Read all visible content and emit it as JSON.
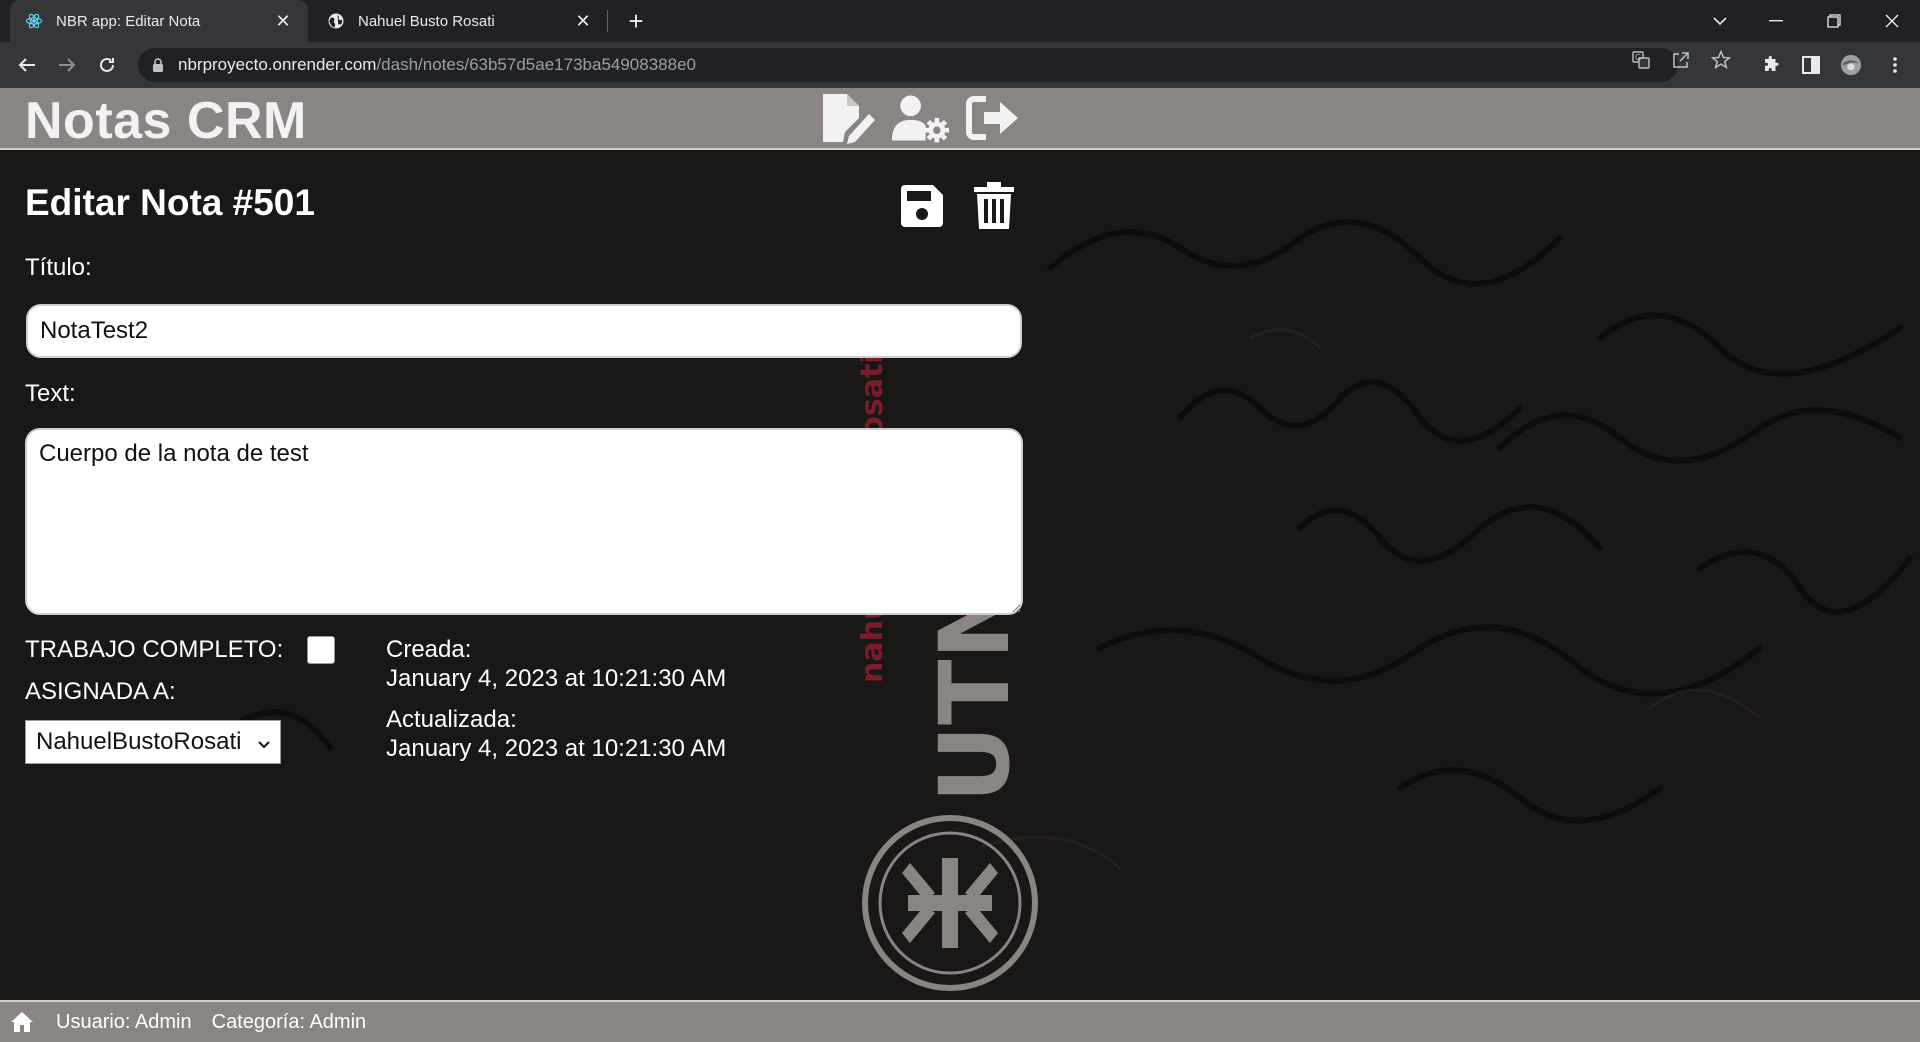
{
  "browser": {
    "tabs": [
      {
        "title": "NBR app: Editar Nota",
        "active": true,
        "favicon": "react-icon"
      },
      {
        "title": "Nahuel Busto Rosati",
        "active": false,
        "favicon": "globe-icon"
      }
    ],
    "url_host": "nbrproyecto.onrender.com",
    "url_path": "/dash/notes/63b57d5ae173ba54908388e0"
  },
  "app": {
    "brand": "Notas CRM",
    "header_icons": [
      "edit-note-icon",
      "user-settings-icon",
      "logout-icon"
    ],
    "form": {
      "title": "Editar Nota #501",
      "titulo_label": "Título:",
      "titulo_value": "NotaTest2",
      "text_label": "Text:",
      "text_value": "Cuerpo de la nota de test",
      "completed_label": "TRABAJO COMPLETO:",
      "completed": false,
      "assigned_label": "ASIGNADA A:",
      "assigned_value": "NahuelBustoRosati",
      "created_label": "Creada:",
      "created_value": "January 4, 2023 at 10:21:30 AM",
      "updated_label": "Actualizada:",
      "updated_value": "January 4, 2023 at 10:21:30 AM"
    },
    "watermark": {
      "text_a": "nahuel busto rosati",
      "text_b": "UTNBR"
    },
    "footer": {
      "user": "Usuario: Admin",
      "category": "Categoría: Admin"
    },
    "colors": {
      "header": "#8a8483",
      "background": "#1a1817",
      "accent_red": "#7a1d2a"
    }
  }
}
